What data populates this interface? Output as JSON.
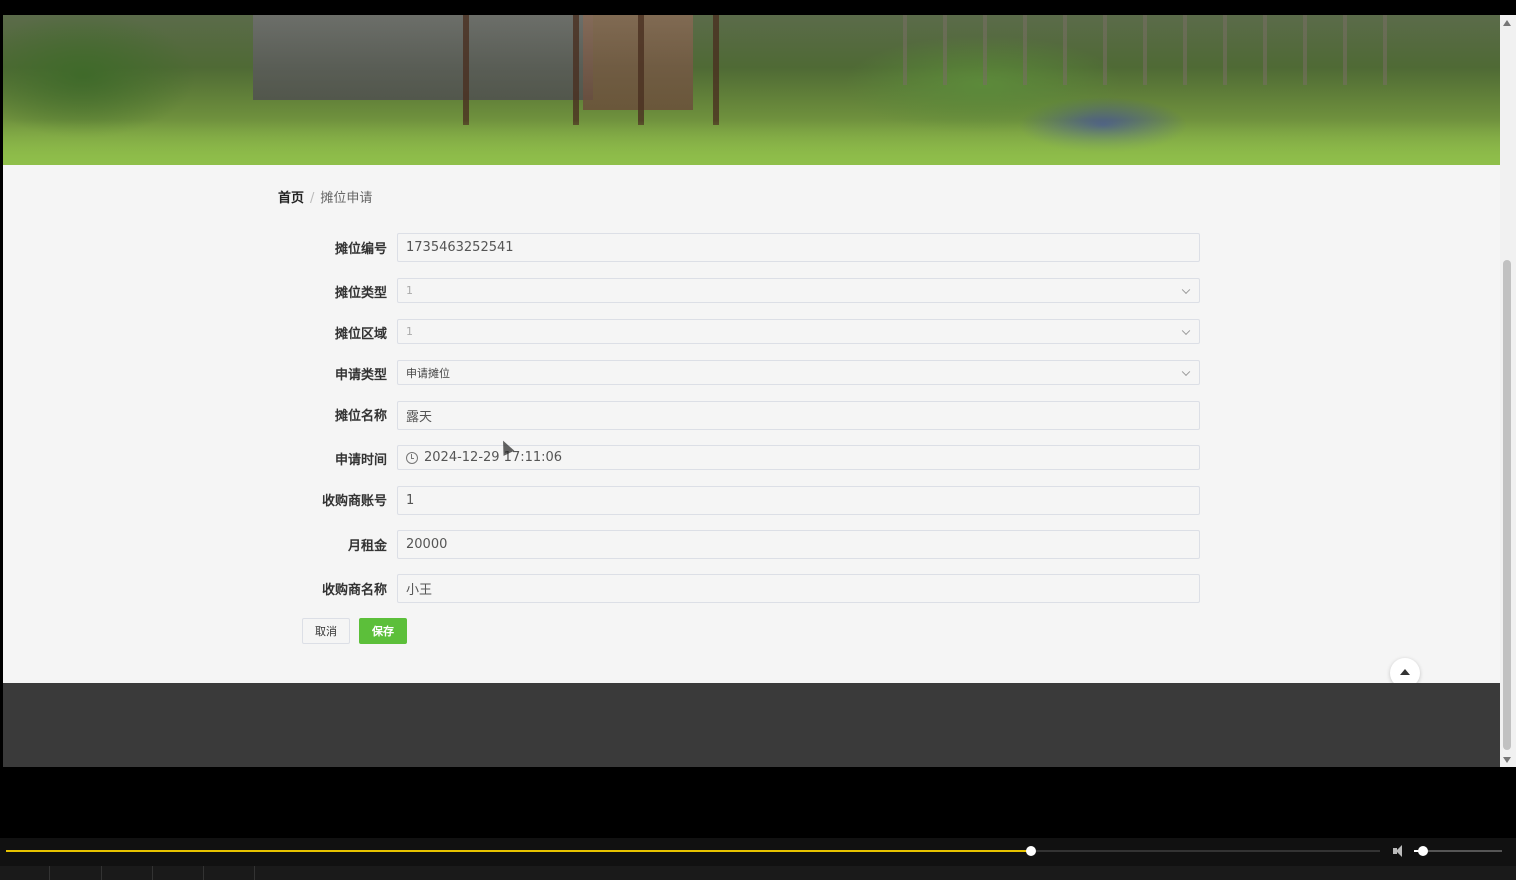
{
  "breadcrumb": {
    "home": "首页",
    "separator": "/",
    "current": "摊位申请"
  },
  "form": {
    "stall_number": {
      "label": "摊位编号",
      "value": "1735463252541"
    },
    "stall_type": {
      "label": "摊位类型",
      "value": "1"
    },
    "stall_area": {
      "label": "摊位区域",
      "value": "1"
    },
    "apply_type": {
      "label": "申请类型",
      "value": "申请摊位"
    },
    "stall_name": {
      "label": "摊位名称",
      "value": "露天"
    },
    "apply_time": {
      "label": "申请时间",
      "value": "2024-12-29 17:11:06"
    },
    "buyer_account": {
      "label": "收购商账号",
      "value": "1"
    },
    "monthly_rent": {
      "label": "月租金",
      "value": "20000"
    },
    "buyer_name": {
      "label": "收购商名称",
      "value": "小王"
    }
  },
  "buttons": {
    "cancel": "取消",
    "save": "保存"
  },
  "player": {
    "progress": 0.746,
    "volume": 0.1
  },
  "colors": {
    "primary": "#5cbf3a",
    "footer": "#3a3a3a",
    "progress": "#e6c200"
  },
  "icons": {
    "time": "clock-icon",
    "select": "chevron-down-icon",
    "back_to_top": "arrow-up-icon",
    "volume": "speaker-icon"
  }
}
